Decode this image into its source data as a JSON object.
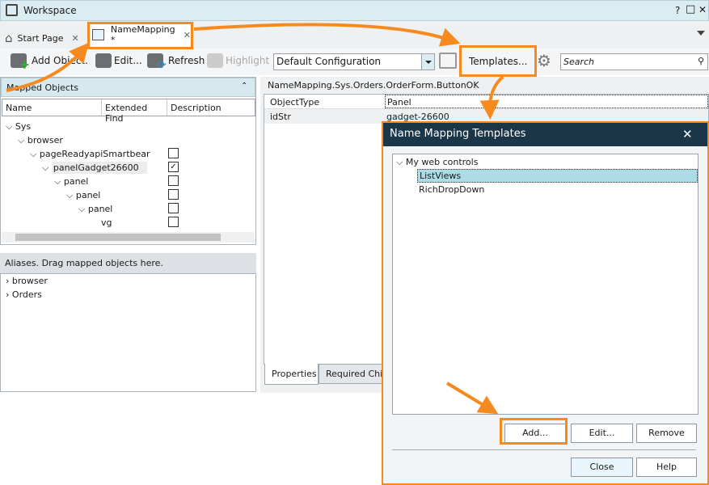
{
  "window": {
    "title": "Workspace",
    "help": "?",
    "maximize": "□",
    "close": "✕"
  },
  "tabs": [
    {
      "label": "Start Page",
      "close": "✕"
    },
    {
      "label": "NameMapping *",
      "close": "✕"
    }
  ],
  "toolbar": {
    "add_object": "Add Object...",
    "edit": "Edit...",
    "refresh": "Refresh",
    "highlight": "Highlight",
    "configuration": "Default Configuration",
    "templates": "Templates...",
    "search_placeholder": "Search"
  },
  "mapped_objects": {
    "title": "Mapped Objects",
    "columns": [
      "Name",
      "Extended Find",
      "Description"
    ],
    "tree": [
      {
        "label": "Sys"
      },
      {
        "label": "browser"
      },
      {
        "label": "pageReadyapiSmartbear",
        "checked": false
      },
      {
        "label": "panelGadget26600",
        "checked": true
      },
      {
        "label": "panel",
        "checked": false
      },
      {
        "label": "panel",
        "checked": false
      },
      {
        "label": "panel",
        "checked": false
      },
      {
        "label": "vg",
        "checked": false
      }
    ]
  },
  "aliases": {
    "title": "Aliases. Drag mapped objects here.",
    "items": [
      "browser",
      "Orders"
    ]
  },
  "properties": {
    "path": "NameMapping.Sys.Orders.OrderForm.ButtonOK",
    "rows": [
      {
        "name": "ObjectType",
        "value": "Panel"
      },
      {
        "name": "idStr",
        "value": "gadget-26600"
      }
    ],
    "tabs": [
      "Properties",
      "Required Child"
    ]
  },
  "dialog": {
    "title": "Name Mapping Templates",
    "close": "✕",
    "group": "My web controls",
    "items": [
      "ListViews",
      "RichDropDown"
    ],
    "buttons": {
      "add": "Add...",
      "edit": "Edit...",
      "remove": "Remove",
      "close": "Close",
      "help": "Help"
    }
  },
  "colors": {
    "accent": "#f68a1e",
    "dialog_title": "#1b3549",
    "selection": "#acdde6"
  }
}
